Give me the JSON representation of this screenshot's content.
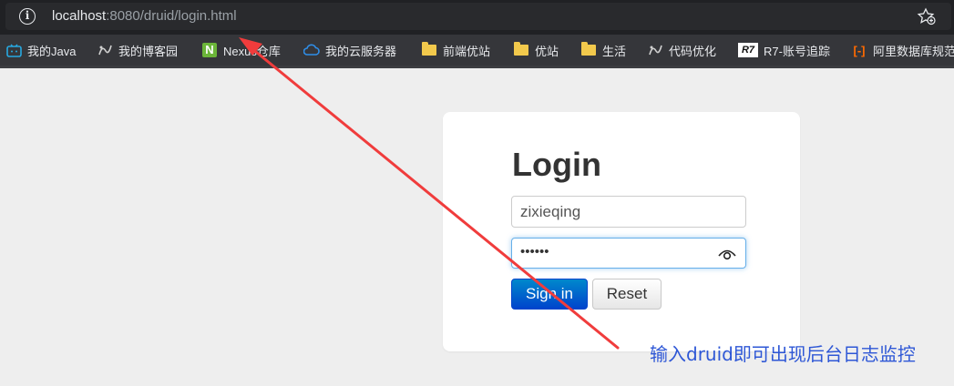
{
  "browser": {
    "url_host": "localhost",
    "url_rest": ":8080/druid/login.html",
    "bookmarks": [
      {
        "label": "我的Java",
        "icon": "bilibili-tv-icon"
      },
      {
        "label": "我的博客园",
        "icon": "cnblogs-icon"
      },
      {
        "label": "Nexus仓库",
        "icon": "nexus-n-icon"
      },
      {
        "label": "我的云服务器",
        "icon": "cloud-icon"
      },
      {
        "label": "前端优站",
        "icon": "folder-icon"
      },
      {
        "label": "优站",
        "icon": "folder-icon"
      },
      {
        "label": "生活",
        "icon": "folder-icon"
      },
      {
        "label": "代码优化",
        "icon": "cnblogs-icon"
      },
      {
        "label": "R7-账号追踪",
        "icon": "r7-icon"
      },
      {
        "label": "阿里数据库规范",
        "icon": "aliyun-icon"
      }
    ]
  },
  "login": {
    "title": "Login",
    "username_value": "zixieqing",
    "password_dots": "••••••",
    "signin_label": "Sign in",
    "reset_label": "Reset"
  },
  "annotation": {
    "text": "输入druid即可出现后台日志监控",
    "color": "#2e57d6",
    "arrow_color": "#f03c3c"
  }
}
